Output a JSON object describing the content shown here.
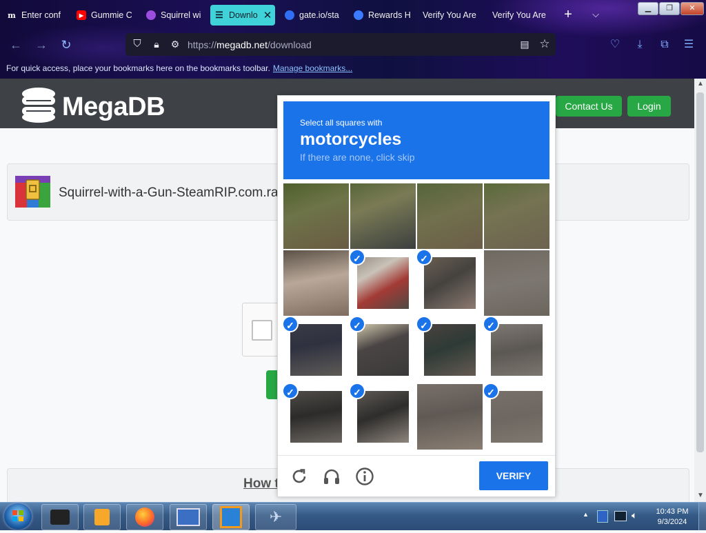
{
  "browser": {
    "tabs": [
      {
        "label": "Enter conf",
        "icon": "medium-icon"
      },
      {
        "label": "Gummie C",
        "icon": "youtube-icon"
      },
      {
        "label": "Squirrel wi",
        "icon": "app-icon"
      },
      {
        "label": "Downlo",
        "icon": "megadb-icon",
        "active": true
      },
      {
        "label": "gate.io/sta",
        "icon": "gate-icon"
      },
      {
        "label": "Rewards H",
        "icon": "rewards-icon"
      },
      {
        "label": "Verify You Are",
        "icon": ""
      },
      {
        "label": "Verify You Are",
        "icon": ""
      }
    ],
    "url_prefix": "https://",
    "url_domain": "megadb.net",
    "url_path": "/download",
    "bookmarks_text": "For quick access, place your bookmarks here on the bookmarks toolbar.",
    "bookmarks_link": "Manage bookmarks..."
  },
  "site": {
    "logo_text": "MegaDB",
    "nav": {
      "contact": "Contact Us",
      "login": "Login"
    },
    "file_name": "Squirrel-with-a-Gun-SteamRIP.com.rar",
    "howto_heading": "How t"
  },
  "captcha": {
    "instruction": "Select all squares with",
    "target": "motorcycles",
    "hint": "If there are none, click skip",
    "verify_label": "VERIFY",
    "tiles_selected": [
      false,
      false,
      false,
      false,
      false,
      true,
      true,
      false,
      true,
      true,
      true,
      true,
      true,
      true,
      false,
      true
    ]
  },
  "taskbar": {
    "time": "10:43 PM",
    "date": "9/3/2024"
  },
  "colors": {
    "captcha_blue": "#1a73e8",
    "green": "#28a745",
    "site_header": "#3e4246",
    "active_tab": "#3fd2d8"
  }
}
